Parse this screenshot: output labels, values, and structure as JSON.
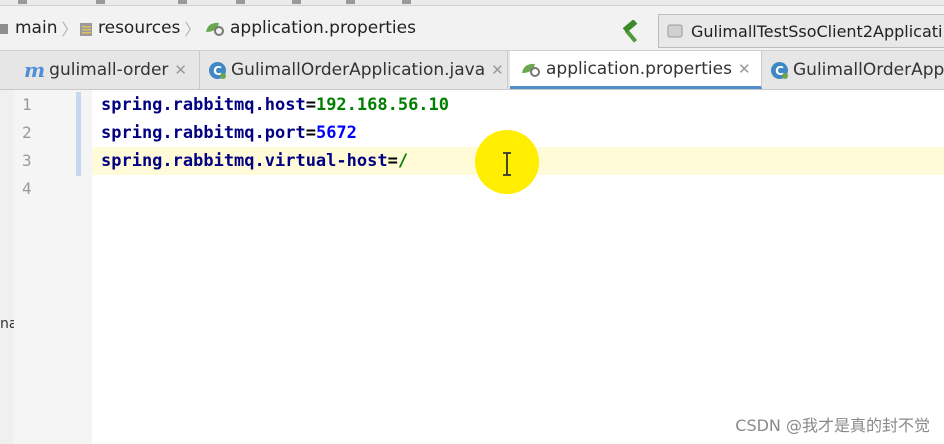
{
  "breadcrumb": {
    "items": [
      "main",
      "resources",
      "application.properties"
    ]
  },
  "toolbar": {
    "run_config": "GulimallTestSsoClient2Applicati"
  },
  "tabs": [
    {
      "label": "gulimall-order",
      "icon": "module-icon",
      "active": false
    },
    {
      "label": "GulimallOrderApplication.java",
      "icon": "class-icon",
      "active": false
    },
    {
      "label": "application.properties",
      "icon": "properties-icon",
      "active": true
    },
    {
      "label": "GulimallOrderAppl",
      "icon": "class-icon",
      "active": false
    }
  ],
  "editor": {
    "line_numbers": [
      "1",
      "2",
      "3",
      "4"
    ],
    "lines": [
      {
        "key": "spring.rabbitmq.host",
        "eq": "=",
        "value": "192.168.56.10"
      },
      {
        "key": "spring.rabbitmq.port",
        "eq": "=",
        "value": "5672"
      },
      {
        "key": "spring.rabbitmq.virtual-host",
        "eq": "=",
        "value": "/"
      }
    ]
  },
  "left_strip": {
    "fragment": "na"
  },
  "watermark": "CSDN @我才是真的封不觉",
  "colors": {
    "key": "#000080",
    "value_string": "#008000",
    "value_number": "#0000ff",
    "active_tab_underline": "#4f8cc9",
    "cursor_highlight": "#ffee00"
  }
}
